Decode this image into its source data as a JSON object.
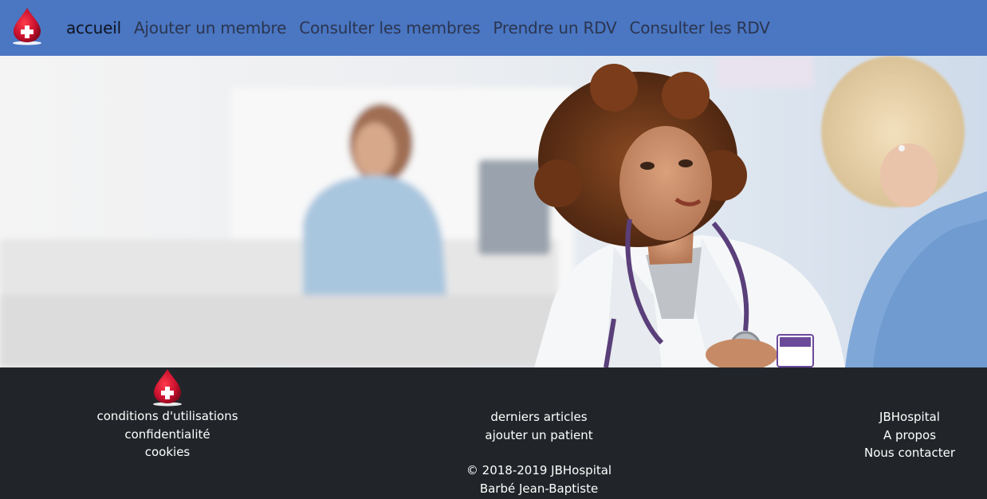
{
  "nav": {
    "logo_icon": "blood-drop-cross-icon",
    "links": [
      {
        "label": "accueil",
        "active": true
      },
      {
        "label": "Ajouter un membre",
        "active": false
      },
      {
        "label": "Consulter les membres",
        "active": false
      },
      {
        "label": "Prendre un RDV",
        "active": false
      },
      {
        "label": "Consulter les RDV",
        "active": false
      }
    ]
  },
  "hero": {
    "image": "doctor-with-patient-photo"
  },
  "footer": {
    "logo_icon": "blood-drop-cross-icon",
    "left_links": [
      "conditions d'utilisations",
      "confidentialité",
      "cookies"
    ],
    "middle_links": [
      "derniers articles",
      "ajouter un patient"
    ],
    "right_links": [
      "JBHospital",
      "A propos",
      "Nous contacter"
    ],
    "copyright": "© 2018-2019 JBHospital",
    "author": "Barbé Jean-Baptiste"
  },
  "colors": {
    "navbar": "#4a76c2",
    "footer": "#212529",
    "drop": "#c8102e"
  }
}
